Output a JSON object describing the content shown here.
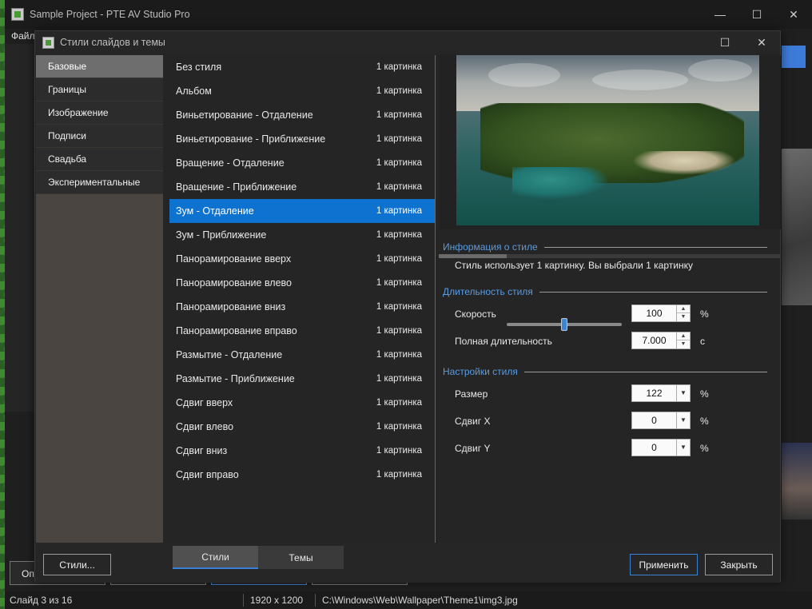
{
  "app": {
    "title": "Sample Project - PTE AV Studio Pro",
    "menu_first": "Файл",
    "minimize_glyph": "—",
    "maximize_glyph": "☐",
    "close_glyph": "✕",
    "bottom_button_first": "Оп"
  },
  "statusbar": {
    "slide": "Слайд 3 из 16",
    "resolution": "1920 x 1200",
    "path": "C:\\Windows\\Web\\Wallpaper\\Theme1\\img3.jpg"
  },
  "dialog": {
    "title": "Стили слайдов и темы",
    "maximize_glyph": "☐",
    "close_glyph": "✕",
    "categories": [
      {
        "label": "Базовые",
        "active": true
      },
      {
        "label": "Границы",
        "active": false
      },
      {
        "label": "Изображение",
        "active": false
      },
      {
        "label": "Подписи",
        "active": false
      },
      {
        "label": "Свадьба",
        "active": false
      },
      {
        "label": "Экспериментальные",
        "active": false
      }
    ],
    "styles": [
      {
        "name": "Без стиля",
        "count": "1 картинка"
      },
      {
        "name": "Альбом",
        "count": "1 картинка"
      },
      {
        "name": "Виньетирование - Отдаление",
        "count": "1 картинка"
      },
      {
        "name": "Виньетирование - Приближение",
        "count": "1 картинка"
      },
      {
        "name": "Вращение - Отдаление",
        "count": "1 картинка"
      },
      {
        "name": "Вращение - Приближение",
        "count": "1 картинка"
      },
      {
        "name": "Зум - Отдаление",
        "count": "1 картинка",
        "selected": true
      },
      {
        "name": "Зум - Приближение",
        "count": "1 картинка"
      },
      {
        "name": "Панорамирование вверх",
        "count": "1 картинка"
      },
      {
        "name": "Панорамирование влево",
        "count": "1 картинка"
      },
      {
        "name": "Панорамирование вниз",
        "count": "1 картинка"
      },
      {
        "name": "Панорамирование вправо",
        "count": "1 картинка"
      },
      {
        "name": "Размытие - Отдаление",
        "count": "1 картинка"
      },
      {
        "name": "Размытие - Приближение",
        "count": "1 картинка"
      },
      {
        "name": "Сдвиг вверх",
        "count": "1 картинка"
      },
      {
        "name": "Сдвиг влево",
        "count": "1 картинка"
      },
      {
        "name": "Сдвиг вниз",
        "count": "1 картинка"
      },
      {
        "name": "Сдвиг вправо",
        "count": "1 картинка"
      }
    ],
    "info": {
      "header": "Информация о стиле",
      "text": "Стиль использует 1 картинку. Вы выбрали 1 картинку"
    },
    "duration": {
      "header": "Длительность стиля",
      "speed_label": "Скорость",
      "speed_value": "100",
      "speed_unit": "%",
      "speed_slider_level": 0.5,
      "total_label": "Полная длительность",
      "total_value": "7.000",
      "total_unit": "с"
    },
    "settings": {
      "header": "Настройки стиля",
      "size_label": "Размер",
      "size_value": "122",
      "size_unit": "%",
      "shiftx_label": "Сдвиг X",
      "shiftx_value": "0",
      "shiftx_unit": "%",
      "shifty_label": "Сдвиг Y",
      "shifty_value": "0",
      "shifty_unit": "%"
    },
    "buttons": {
      "styles": "Стили...",
      "apply": "Применить",
      "close": "Закрыть"
    },
    "tabs": [
      {
        "label": "Стили",
        "active": true
      },
      {
        "label": "Темы",
        "active": false
      }
    ],
    "colors": {
      "selection": "#0e73d0",
      "section_header": "#5b9be0",
      "primary_border": "#3b82d6"
    }
  }
}
